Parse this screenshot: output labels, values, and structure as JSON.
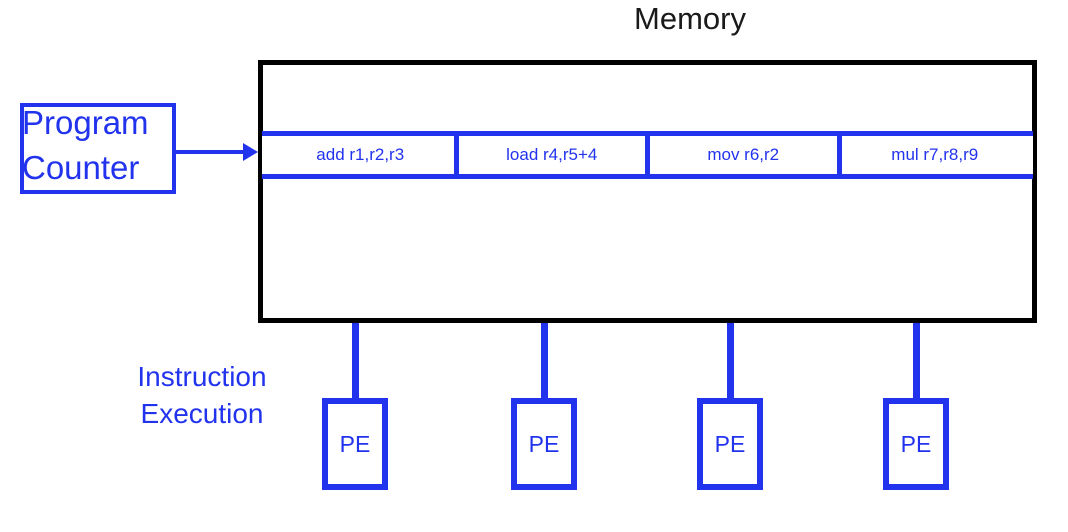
{
  "diagram": {
    "title": "Memory",
    "memory": {
      "label": "Memory",
      "instructions": [
        "add r1,r2,r3",
        "load r4,r5+4",
        "mov r6,r2",
        "mul r7,r8,r9"
      ]
    },
    "program_counter": {
      "line1": "Program",
      "line2": "Counter",
      "arrow": "right-arrow"
    },
    "execution": {
      "line1": "Instruction",
      "line2": "Execution"
    },
    "processing_elements": [
      {
        "label": "PE"
      },
      {
        "label": "PE"
      },
      {
        "label": "PE"
      },
      {
        "label": "PE"
      }
    ],
    "colors": {
      "accent_blue": "#2233ee",
      "outline_black": "#000000",
      "background": "#ffffff"
    }
  }
}
